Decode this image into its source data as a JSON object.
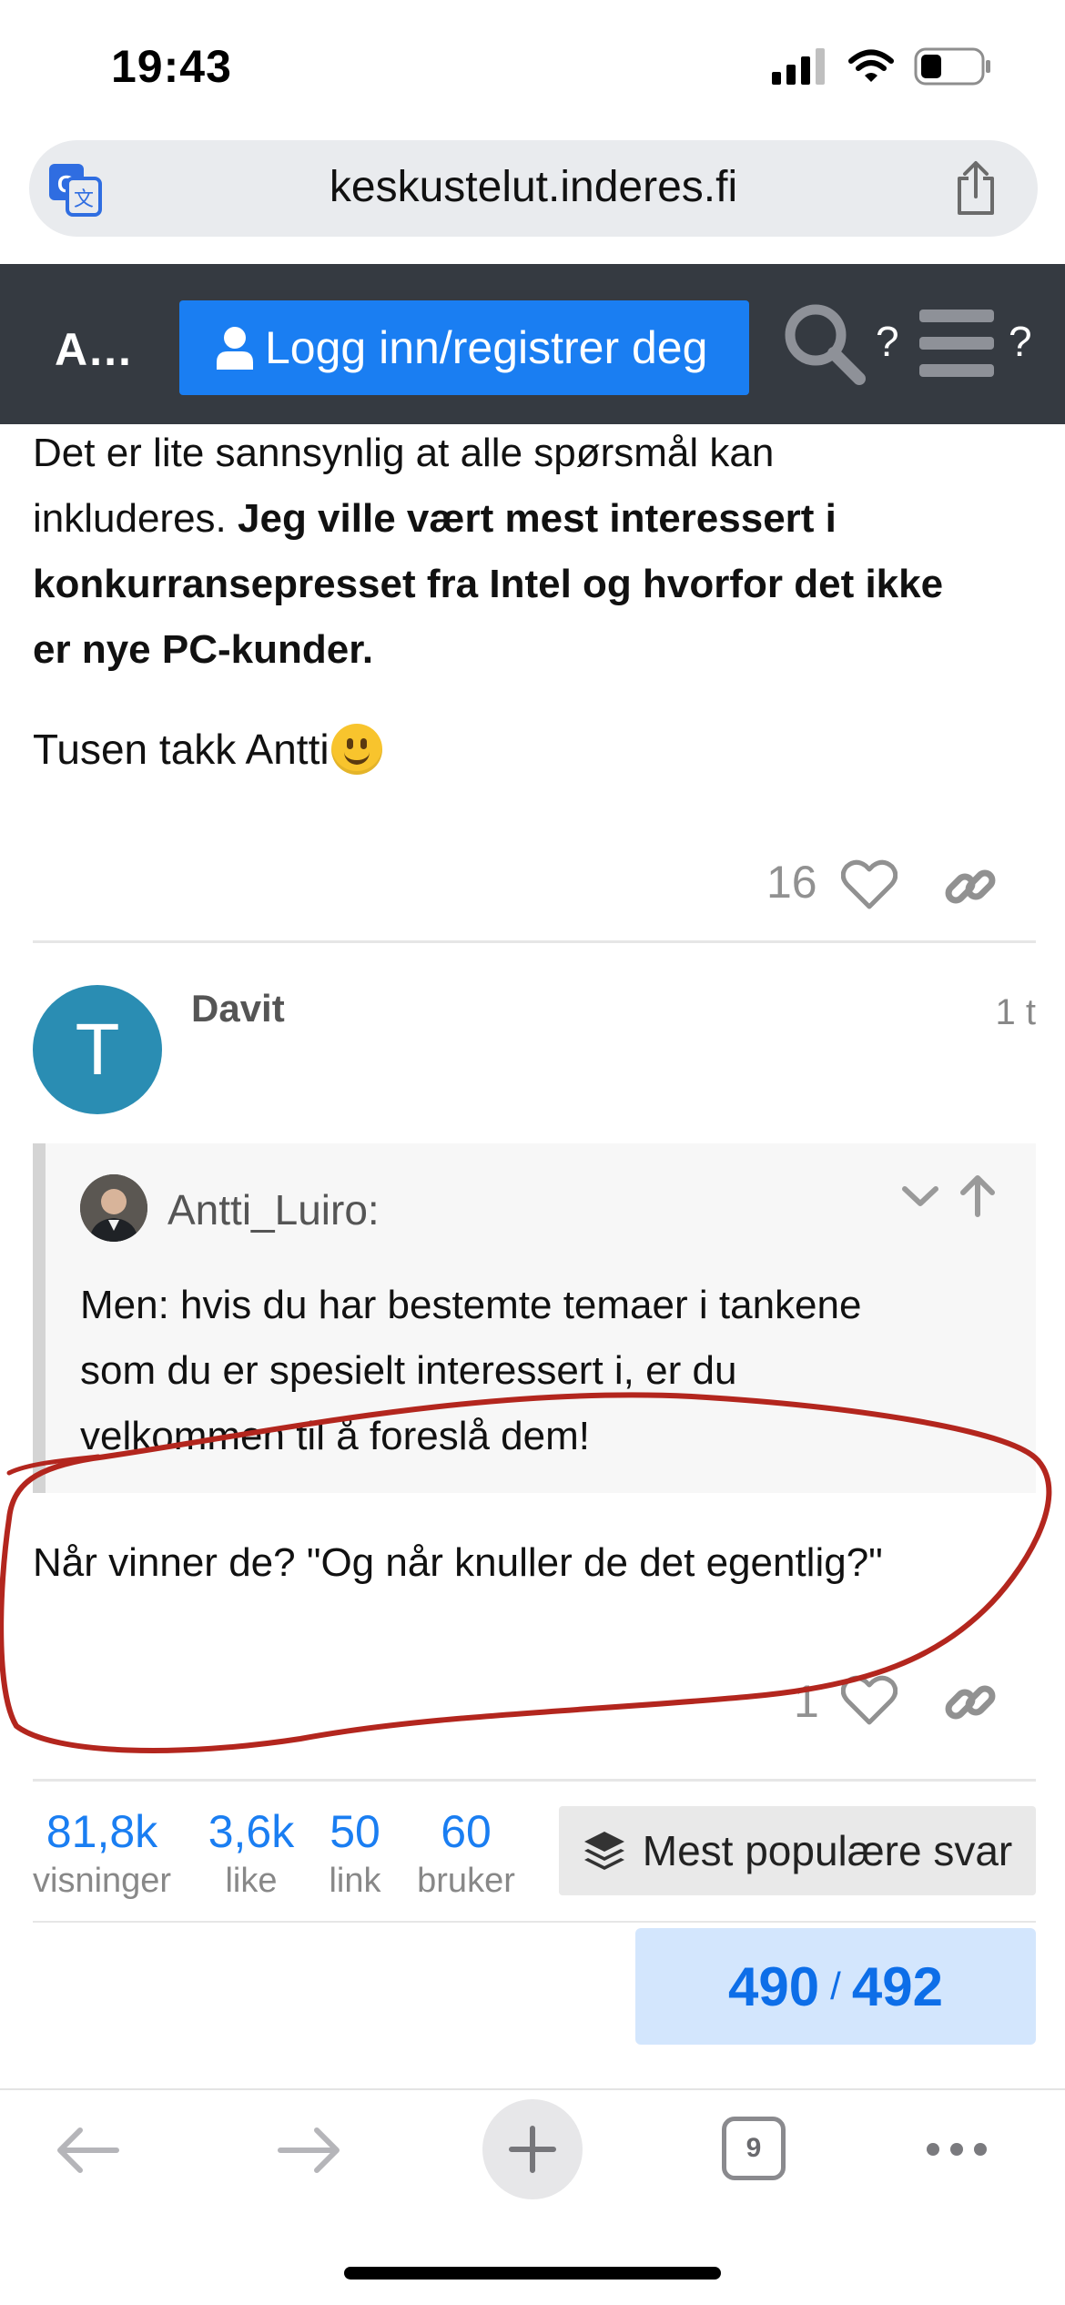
{
  "status_bar": {
    "time": "19:43"
  },
  "browser": {
    "url": "keskustelut.inderes.fi",
    "tab_count": "9"
  },
  "header": {
    "site_name": "A…",
    "login_label": "Logg inn/registrer deg",
    "search_q": "?",
    "menu_q": "?"
  },
  "post1": {
    "line1": "Det er lite sannsynlig at alle spørsmål kan",
    "line2_plain": "inkluderes. ",
    "line2_bold": "Jeg ville vært mest interessert i",
    "line3_bold": "konkurransepresset fra Intel og hvorfor det ikke",
    "line4_bold": "er nye PC-kunder.",
    "thanks": "Tusen takk Antti",
    "like_count": "16"
  },
  "post2": {
    "avatar_letter": "T",
    "author": "Davit",
    "time": "1 t",
    "quote_author": "Antti_Luiro:",
    "quote_line1": "Men: hvis du har bestemte temaer i tankene",
    "quote_line2": "som du er spesielt interessert i, er du",
    "quote_line3": "velkommen til å foreslå dem!",
    "reply": "Når vinner de? \"Og når knuller de det egentlig?\"",
    "like_count": "1"
  },
  "stats": [
    {
      "value": "81,8k",
      "label": "visninger"
    },
    {
      "value": "3,6k",
      "label": "like"
    },
    {
      "value": "50",
      "label": "link"
    },
    {
      "value": "60",
      "label": "bruker"
    }
  ],
  "popular_label": "Mest populære svar",
  "progress": {
    "current": "490",
    "total": "492"
  },
  "colors": {
    "accent": "#1a7ef2",
    "header_bg": "#353a41",
    "avatar_bg": "#2a8db3",
    "annotation": "#b3261e"
  }
}
